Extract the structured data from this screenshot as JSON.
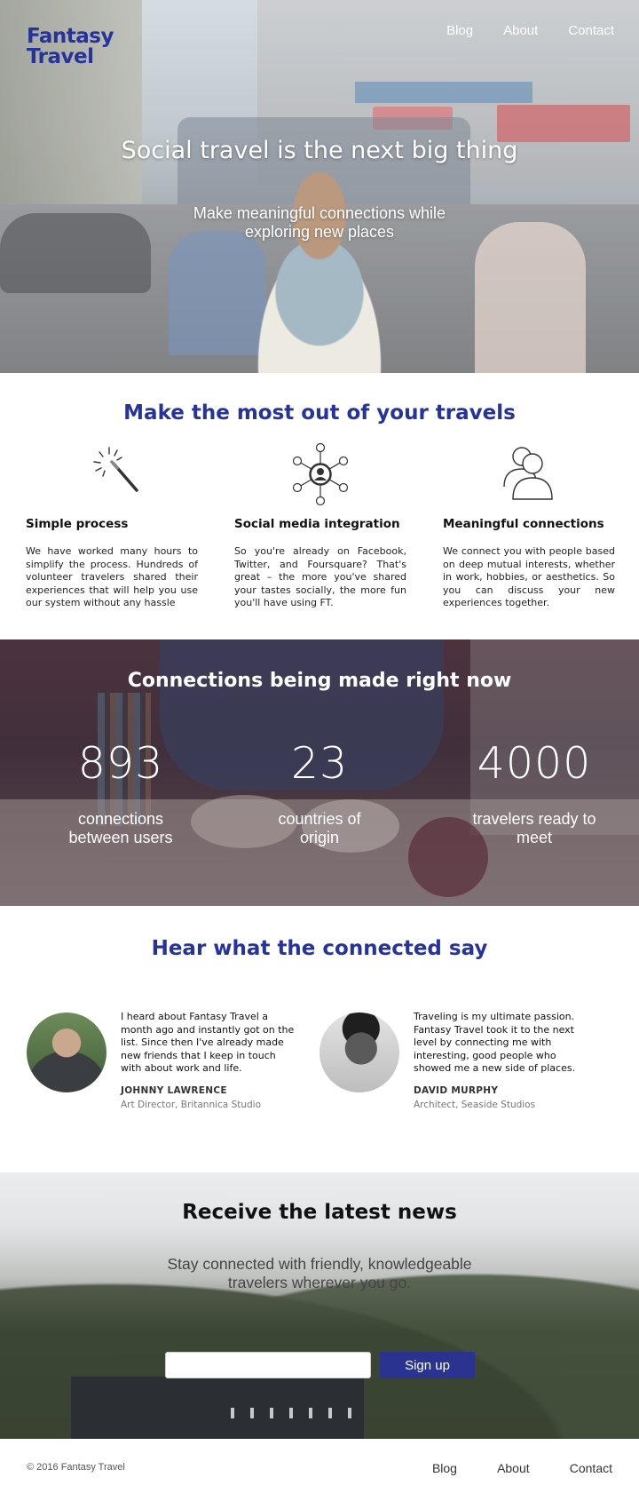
{
  "brand": {
    "name_line1": "Fantasy",
    "name_line2": "Travel"
  },
  "nav": {
    "items": [
      "Blog",
      "About",
      "Contact"
    ]
  },
  "hero": {
    "title": "Social travel is the next big thing",
    "subtitle": "Make meaningful connections while exploring new places"
  },
  "features": {
    "title": "Make the most out of your travels",
    "items": [
      {
        "icon": "magic-wand-icon",
        "title": "Simple process",
        "text": "We have worked many hours to simplify the process. Hundreds of volunteer travelers shared their experiences that will help you use our system without any hassle"
      },
      {
        "icon": "social-network-icon",
        "title": "Social media integration",
        "text": "So you're already on Facebook, Twitter, and Foursquare? That's great – the more you've shared your tastes socially, the more fun you'll have using FT."
      },
      {
        "icon": "users-icon",
        "title": "Meaningful connections",
        "text": "We connect you with people based on deep mutual interests, whether in work, hobbies, or aesthetics. So you can discuss your new experiences together."
      }
    ]
  },
  "stats": {
    "title": "Connections being made right now",
    "items": [
      {
        "value": "893",
        "label": "connections between users"
      },
      {
        "value": "23",
        "label": "countries of origin"
      },
      {
        "value": "4000",
        "label": "travelers ready to meet"
      }
    ]
  },
  "testimonials": {
    "title": "Hear what the connected say",
    "items": [
      {
        "quote": "I heard about Fantasy Travel a month ago and instantly got on the list. Since then I've already made new friends that I keep in touch with about work and life.",
        "name": "JOHNNY LAWRENCE",
        "role": "Art Director, Britannica Studio"
      },
      {
        "quote": "Traveling is my ultimate passion. Fantasy Travel took it to the next level by connecting me with interesting, good people who showed me a new side of places.",
        "name": "DAVID MURPHY",
        "role": "Architect, Seaside Studios"
      }
    ]
  },
  "newsletter": {
    "title": "Receive the latest news",
    "subtitle": "Stay connected with friendly, knowledgeable travelers wherever you go.",
    "email_value": "",
    "button": "Sign up"
  },
  "footer": {
    "copyright": "© 2016 Fantasy Travel",
    "items": [
      "Blog",
      "About",
      "Contact"
    ]
  },
  "colors": {
    "brand_blue": "#26339a",
    "button_blue": "#2a338f"
  }
}
